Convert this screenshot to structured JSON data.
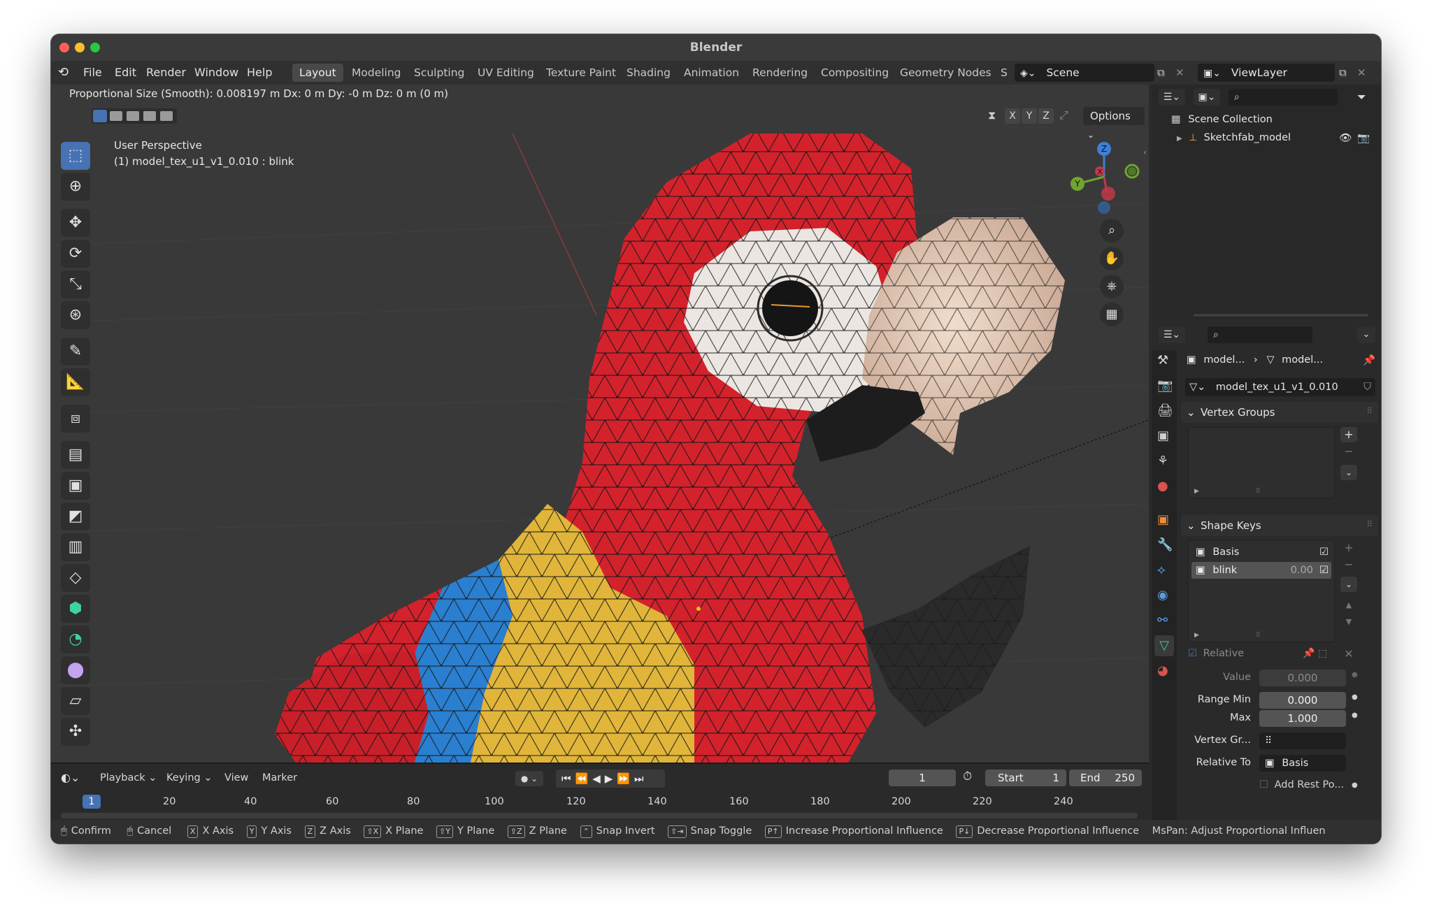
{
  "app": {
    "title": "Blender"
  },
  "menu": [
    "File",
    "Edit",
    "Render",
    "Window",
    "Help"
  ],
  "workspaces": [
    "Layout",
    "Modeling",
    "Sculpting",
    "UV Editing",
    "Texture Paint",
    "Shading",
    "Animation",
    "Rendering",
    "Compositing",
    "Geometry Nodes",
    "S"
  ],
  "scene": {
    "label": "Scene",
    "view_layer": "ViewLayer"
  },
  "viewport": {
    "header_info": "Proportional Size (Smooth): 0.008197 m   Dx: 0 m   Dy: -0 m   Dz: 0 m (0 m)",
    "perspective": "User Perspective",
    "object_info": "(1) model_tex_u1_v1_0.010 : blink",
    "axes": [
      "X",
      "Y",
      "Z"
    ],
    "options_label": "Options",
    "gizmo_labels": {
      "z": "Z",
      "y": "Y",
      "x": "X"
    }
  },
  "timeline": {
    "menus": [
      "Playback",
      "Keying",
      "View",
      "Marker"
    ],
    "current_frame": "1",
    "start_label": "Start",
    "start": "1",
    "end_label": "End",
    "end": "250",
    "ruler": [
      "1",
      "20",
      "40",
      "60",
      "80",
      "100",
      "120",
      "140",
      "160",
      "180",
      "200",
      "220",
      "240"
    ]
  },
  "statusbar": [
    {
      "key": "",
      "label": "Confirm"
    },
    {
      "key": "",
      "label": "Cancel"
    },
    {
      "key": "X",
      "label": "X Axis"
    },
    {
      "key": "Y",
      "label": "Y Axis"
    },
    {
      "key": "Z",
      "label": "Z Axis"
    },
    {
      "key": "⇧X",
      "label": "X Plane"
    },
    {
      "key": "⇧Y",
      "label": "Y Plane"
    },
    {
      "key": "⇧Z",
      "label": "Z Plane"
    },
    {
      "key": "⌃",
      "label": "Snap Invert"
    },
    {
      "key": "⇧⇥",
      "label": "Snap Toggle"
    },
    {
      "key": "P↑",
      "label": "Increase Proportional Influence"
    },
    {
      "key": "P↓",
      "label": "Decrease Proportional Influence"
    },
    {
      "key": "",
      "label": "MsPan: Adjust Proportional Influen"
    }
  ],
  "outliner": {
    "root": "Scene Collection",
    "items": [
      {
        "label": "Sketchfab_model"
      }
    ]
  },
  "properties": {
    "breadcrumb": [
      "model...",
      "model..."
    ],
    "mesh_name": "model_tex_u1_v1_0.010",
    "vertex_groups_title": "Vertex Groups",
    "shape_keys_title": "Shape Keys",
    "shape_keys": [
      {
        "name": "Basis",
        "value": ""
      },
      {
        "name": "blink",
        "value": "0.00"
      }
    ],
    "relative_label": "Relative",
    "value_label": "Value",
    "value": "0.000",
    "range_min_label": "Range Min",
    "range_min": "0.000",
    "max_label": "Max",
    "max": "1.000",
    "vertex_group_label": "Vertex Gr...",
    "relative_to_label": "Relative To",
    "relative_to": "Basis",
    "add_rest_label": "Add Rest Po..."
  },
  "colors": {
    "accent": "#4772b3",
    "macaw_red": "#d3222c",
    "macaw_yellow": "#e0b53a",
    "macaw_blue": "#2a7fd0"
  }
}
